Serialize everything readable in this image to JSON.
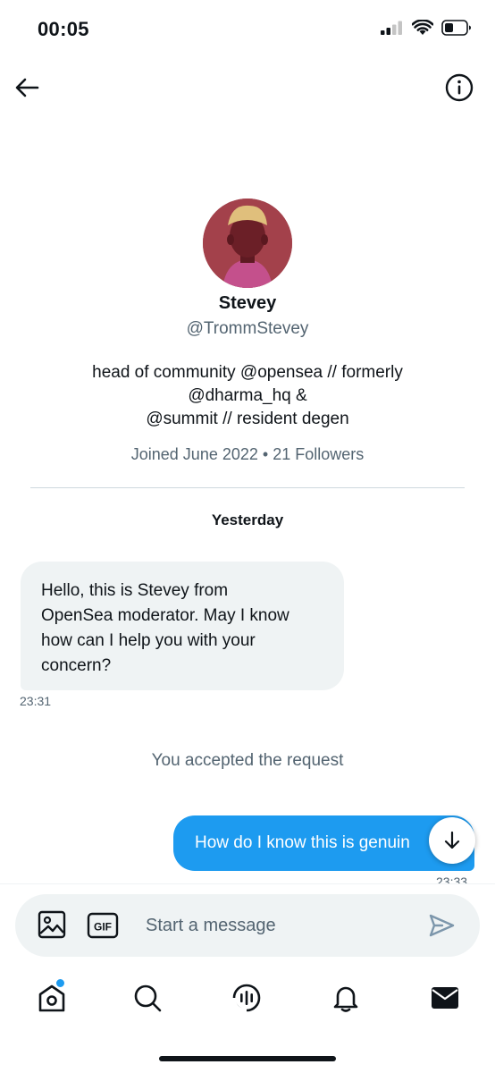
{
  "status_bar": {
    "time": "00:05"
  },
  "profile": {
    "name": "Stevey",
    "handle": "@TrommStevey",
    "bio_lines": [
      "head of community @opensea // formerly",
      "@dharma_hq &",
      "@summit // resident degen"
    ],
    "meta": "Joined June 2022 • 21 Followers"
  },
  "conversation": {
    "date_separator": "Yesterday",
    "incoming": {
      "lines": [
        "Hello, this is Stevey from",
        "OpenSea moderator. May I know",
        "how can I help you with your",
        "concern?"
      ],
      "time": "23:31"
    },
    "system_message": "You accepted the request",
    "outgoing": {
      "text": "How do I know this is genuin",
      "time": "23:33"
    }
  },
  "composer": {
    "placeholder": "Start a message",
    "gif_label": "GIF"
  },
  "icons": {
    "back": "arrow-left-icon",
    "info": "info-icon",
    "scroll": "arrow-down-icon",
    "media": "image-icon",
    "gif": "gif-icon",
    "send": "send-icon",
    "nav": [
      "home-icon",
      "search-icon",
      "spaces-icon",
      "bell-icon",
      "mail-icon"
    ]
  },
  "colors": {
    "accent": "#1d9bf0",
    "secondary_text": "#536471",
    "bubble_in": "#eff3f4"
  }
}
